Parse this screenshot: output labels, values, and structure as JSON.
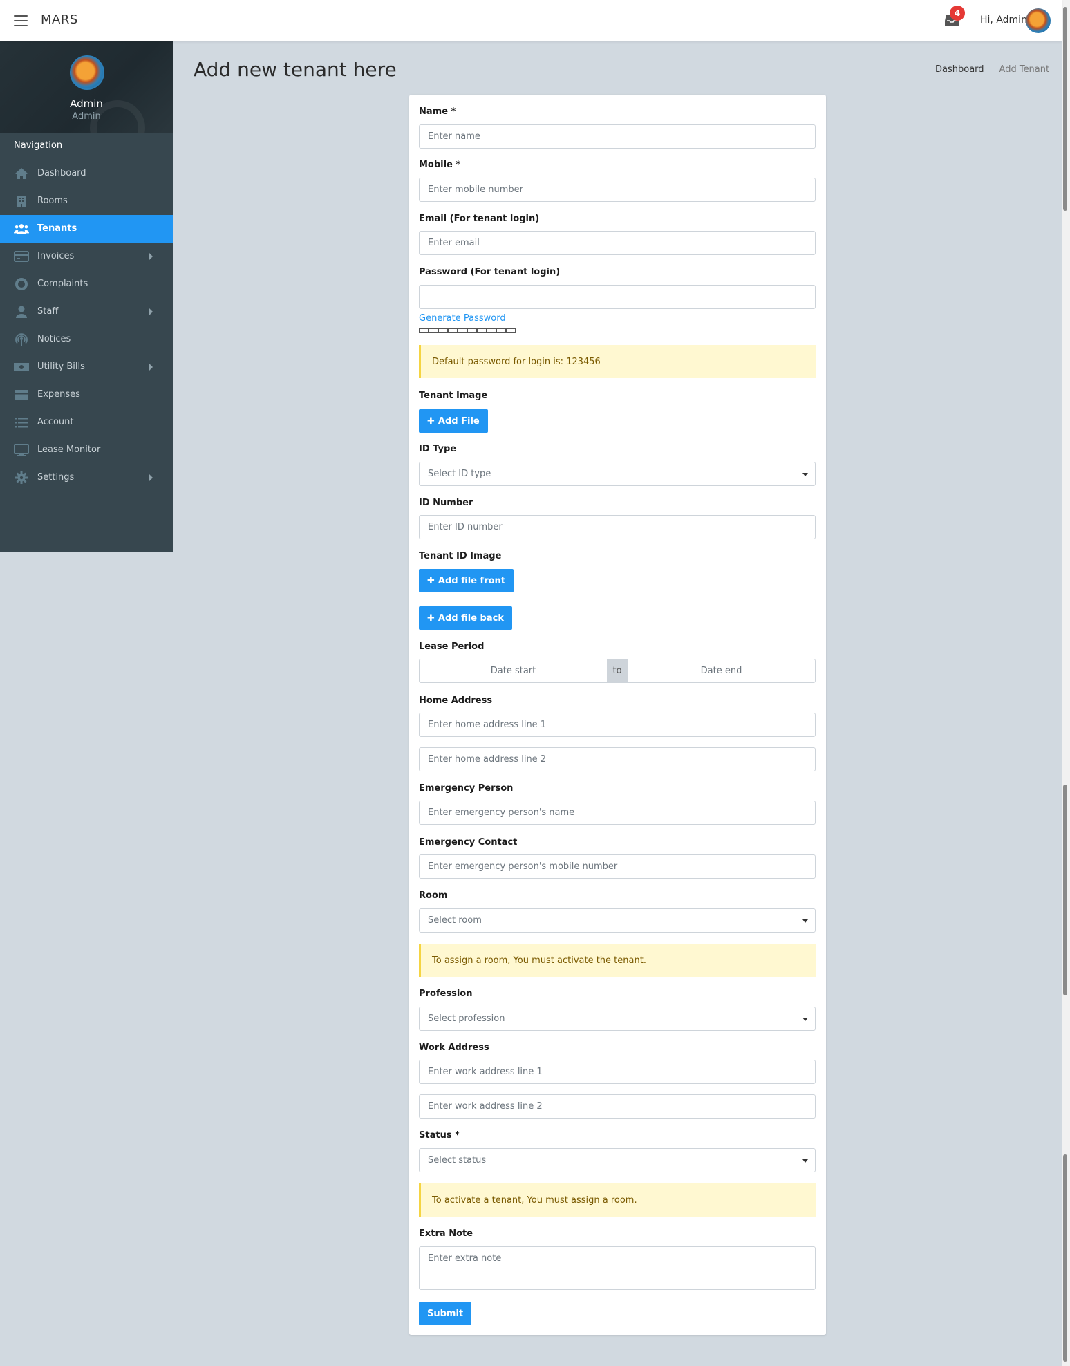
{
  "topbar": {
    "brand": "MARS",
    "notification_count": "4",
    "greeting": "Hi, Admin"
  },
  "sidebar": {
    "profile_name": "Admin",
    "profile_role": "Admin",
    "nav_header": "Navigation",
    "items": [
      {
        "label": "Dashboard",
        "icon": "home-icon"
      },
      {
        "label": "Rooms",
        "icon": "building-icon"
      },
      {
        "label": "Tenants",
        "icon": "users-icon",
        "active": true
      },
      {
        "label": "Invoices",
        "icon": "credit-card-icon",
        "has_submenu": true
      },
      {
        "label": "Complaints",
        "icon": "lifebuoy-icon"
      },
      {
        "label": "Staff",
        "icon": "user-icon",
        "has_submenu": true
      },
      {
        "label": "Notices",
        "icon": "broadcast-icon"
      },
      {
        "label": "Utility Bills",
        "icon": "money-bill-icon",
        "has_submenu": true
      },
      {
        "label": "Expenses",
        "icon": "card-icon"
      },
      {
        "label": "Account",
        "icon": "list-icon"
      },
      {
        "label": "Lease Monitor",
        "icon": "monitor-icon"
      },
      {
        "label": "Settings",
        "icon": "gear-icon",
        "has_submenu": true
      }
    ]
  },
  "page": {
    "title": "Add new tenant here",
    "breadcrumb": [
      "Dashboard",
      "Add Tenant"
    ]
  },
  "form": {
    "name": {
      "label": "Name *",
      "placeholder": "Enter name"
    },
    "mobile": {
      "label": "Mobile *",
      "placeholder": "Enter mobile number"
    },
    "email": {
      "label": "Email (For tenant login)",
      "placeholder": "Enter email"
    },
    "password": {
      "label": "Password (For tenant login)",
      "value": ""
    },
    "generate_password": "Generate Password",
    "password_alert": "Default password for login is: 123456",
    "tenant_image": {
      "label": "Tenant Image",
      "button": "Add File"
    },
    "id_type": {
      "label": "ID Type",
      "selected": "Select ID type"
    },
    "id_number": {
      "label": "ID Number",
      "placeholder": "Enter ID number"
    },
    "tenant_id_image": {
      "label": "Tenant ID Image",
      "button_front": "Add file front",
      "button_back": "Add file back"
    },
    "lease_period": {
      "label": "Lease Period",
      "start_placeholder": "Date start",
      "separator": "to",
      "end_placeholder": "Date end"
    },
    "home_address": {
      "label": "Home Address",
      "line1_placeholder": "Enter home address line 1",
      "line2_placeholder": "Enter home address line 2"
    },
    "emergency_person": {
      "label": "Emergency Person",
      "placeholder": "Enter emergency person's name"
    },
    "emergency_contact": {
      "label": "Emergency Contact",
      "placeholder": "Enter emergency person's mobile number"
    },
    "room": {
      "label": "Room",
      "selected": "Select room"
    },
    "room_alert": "To assign a room, You must activate the tenant.",
    "profession": {
      "label": "Profession",
      "selected": "Select profession"
    },
    "work_address": {
      "label": "Work Address",
      "line1_placeholder": "Enter work address line 1",
      "line2_placeholder": "Enter work address line 2"
    },
    "status": {
      "label": "Status *",
      "selected": "Select status"
    },
    "status_alert": "To activate a tenant, You must assign a room.",
    "extra_note": {
      "label": "Extra Note",
      "placeholder": "Enter extra note"
    },
    "submit": "Submit"
  },
  "colors": {
    "accent": "#2196f3",
    "sidebar_bg": "#37474f",
    "page_bg": "#d1d9e0",
    "alert_bg": "#fff8d1",
    "badge": "#e53935"
  }
}
